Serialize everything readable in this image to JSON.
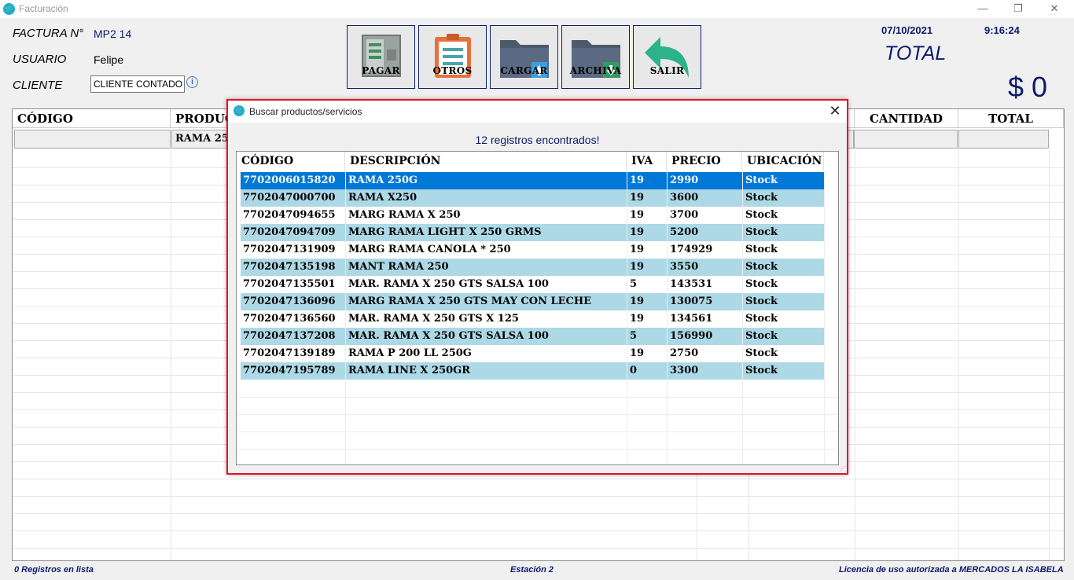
{
  "window": {
    "title": "Facturación",
    "minimize": "—",
    "restore": "❐",
    "close": "✕"
  },
  "header": {
    "factura_label": "FACTURA N°",
    "factura_value": "MP2 14",
    "usuario_label": "USUARIO",
    "usuario_value": "Felipe",
    "cliente_label": "CLIENTE",
    "cliente_value": "CLIENTE CONTADO"
  },
  "toolbar": {
    "pagar": "PAGAR",
    "otros": "OTROS",
    "cargar": "CARGAR",
    "archiva": "ARCHIVA",
    "salir": "SALIR"
  },
  "summary": {
    "date": "07/10/2021",
    "time": "9:16:24",
    "total_label": "TOTAL",
    "total_value": "$ 0"
  },
  "grid": {
    "columns": [
      "CÓDIGO",
      "PRODUC",
      "CANTIDAD",
      "TOTAL"
    ],
    "filter_producto": "RAMA 25"
  },
  "status": {
    "left": "0 Registros en lista",
    "center": "Estación 2",
    "right": "Licencia de uso autorizada a MERCADOS LA ISABELA"
  },
  "dialog": {
    "title": "Buscar productos/servicios",
    "close": "✕",
    "count_text": "12 registros encontrados!",
    "columns": [
      "CÓDIGO",
      "DESCRIPCIÓN",
      "IVA",
      "PRECIO",
      "UBICACIÓN"
    ],
    "rows": [
      {
        "codigo": "7702006015820",
        "descripcion": "RAMA 250G",
        "iva": "19",
        "precio": "2990",
        "ubicacion": "Stock"
      },
      {
        "codigo": "7702047000700",
        "descripcion": "RAMA X250",
        "iva": "19",
        "precio": "3600",
        "ubicacion": "Stock"
      },
      {
        "codigo": "7702047094655",
        "descripcion": "MARG RAMA X 250",
        "iva": "19",
        "precio": "3700",
        "ubicacion": "Stock"
      },
      {
        "codigo": "7702047094709",
        "descripcion": "MARG RAMA LIGHT X 250 GRMS",
        "iva": "19",
        "precio": "5200",
        "ubicacion": "Stock"
      },
      {
        "codigo": "7702047131909",
        "descripcion": "MARG RAMA CANOLA * 250",
        "iva": "19",
        "precio": "174929",
        "ubicacion": "Stock"
      },
      {
        "codigo": "7702047135198",
        "descripcion": "MANT RAMA 250",
        "iva": "19",
        "precio": "3550",
        "ubicacion": "Stock"
      },
      {
        "codigo": "7702047135501",
        "descripcion": "MAR. RAMA X 250 GTS SALSA 100",
        "iva": "5",
        "precio": "143531",
        "ubicacion": "Stock"
      },
      {
        "codigo": "7702047136096",
        "descripcion": "MARG RAMA X 250 GTS MAY CON LECHE",
        "iva": "19",
        "precio": "130075",
        "ubicacion": "Stock"
      },
      {
        "codigo": "7702047136560",
        "descripcion": "MAR. RAMA X 250 GTS X 125",
        "iva": "19",
        "precio": "134561",
        "ubicacion": "Stock"
      },
      {
        "codigo": "7702047137208",
        "descripcion": "MAR. RAMA X 250 GTS SALSA 100",
        "iva": "5",
        "precio": "156990",
        "ubicacion": "Stock"
      },
      {
        "codigo": "7702047139189",
        "descripcion": "RAMA P 200 LL 250G",
        "iva": "19",
        "precio": "2750",
        "ubicacion": "Stock"
      },
      {
        "codigo": "7702047195789",
        "descripcion": "RAMA LINE X 250GR",
        "iva": "0",
        "precio": "3300",
        "ubicacion": "Stock"
      }
    ],
    "selected_index": 0
  },
  "colors": {
    "accent": "#0d1a6b",
    "selection": "#0078d7",
    "alt_row": "#add8e6",
    "dialog_border": "#e81123"
  }
}
